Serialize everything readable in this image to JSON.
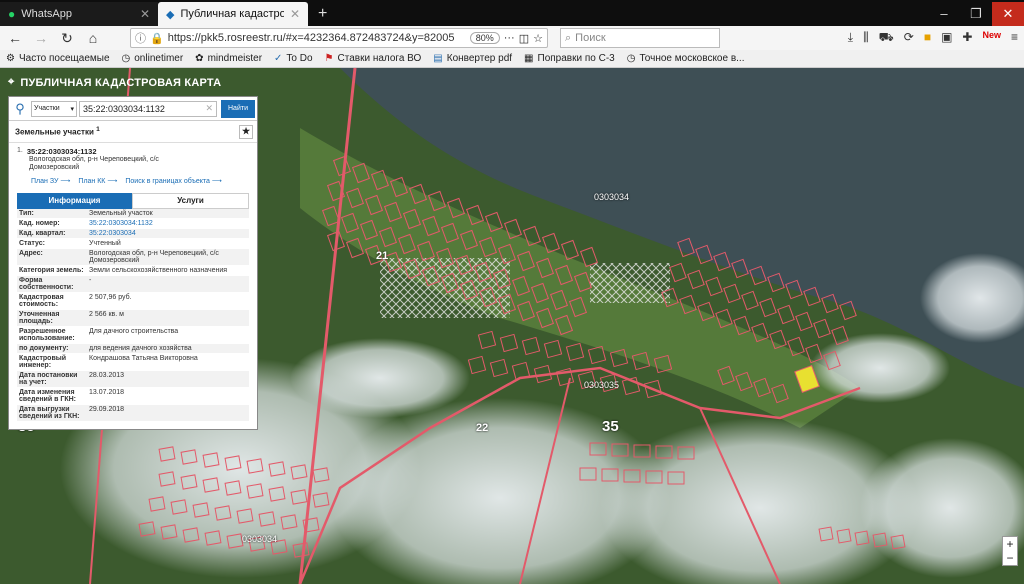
{
  "browser": {
    "tabs": [
      {
        "title": "WhatsApp",
        "icon": "whatsapp-icon",
        "active": false
      },
      {
        "title": "Публичная кадастровая карта",
        "icon": "rosreestr-icon",
        "active": true
      }
    ],
    "url": "https://pkk5.rosreestr.ru/#x=4232364.872483724&y=82005",
    "zoom": "80%",
    "search_placeholder": "Поиск",
    "bookmarks": [
      "Часто посещаемые",
      "onlinetimer",
      "mindmeister",
      "To Do",
      "Ставки налога ВО",
      "Конвертер pdf",
      "Поправки по С-3",
      "Точное московское в..."
    ]
  },
  "app": {
    "title": "ПУБЛИЧНАЯ КАДАСТРОВАЯ КАРТА",
    "search_type": "Участки",
    "search_value": "35:22:0303034:1132",
    "find_button": "Найти",
    "section_title": "Земельные участки",
    "section_sup": "1",
    "result_index": "1.",
    "result_number": "35:22:0303034:1132",
    "result_address_line1": "Вологодская обл, р-н Череповецкий, с/с",
    "result_address_line2": "Домозеровский",
    "links": [
      "План ЗУ ⟶",
      "План КК ⟶",
      "Поиск в границах объекта ⟶"
    ],
    "tabs": [
      "Информация",
      "Услуги"
    ],
    "info_rows": [
      {
        "label": "Тип:",
        "value": "Земельный участок"
      },
      {
        "label": "Кад. номер:",
        "value": "35:22:0303034:1132",
        "link": true
      },
      {
        "label": "Кад. квартал:",
        "value": "35:22:0303034",
        "link": true
      },
      {
        "label": "Статус:",
        "value": "Учтенный"
      },
      {
        "label": "Адрес:",
        "value": "Вологодская обл, р-н Череповецкий, с/с Домозеровский"
      },
      {
        "label": "Категория земель:",
        "value": "Земли сельскохозяйственного назначения"
      },
      {
        "label": "Форма собственности:",
        "value": "-"
      },
      {
        "label": "Кадастровая стоимость:",
        "value": "2 507,96 руб."
      },
      {
        "label": "Уточненная площадь:",
        "value": "2 566 кв. м"
      },
      {
        "label": "Разрешенное использование:",
        "value": "Для дачного строительства"
      },
      {
        "label": "по документу:",
        "value": "для ведения дачного хозяйства"
      },
      {
        "label": "Кадастровый инженер:",
        "value": "Кондрашова Татьяна Викторовна"
      },
      {
        "label": "Дата постановки на учет:",
        "value": "28.03.2013"
      },
      {
        "label": "Дата изменения сведений в ГКН:",
        "value": "13.07.2018"
      },
      {
        "label": "Дата выгрузки сведений из ГКН:",
        "value": "29.09.2018"
      }
    ]
  },
  "map_labels": [
    "21",
    "22",
    "35",
    "35",
    "0303034",
    "0303035",
    "0303034"
  ],
  "map_zoom": {
    "plus": "+",
    "minus": "−"
  }
}
